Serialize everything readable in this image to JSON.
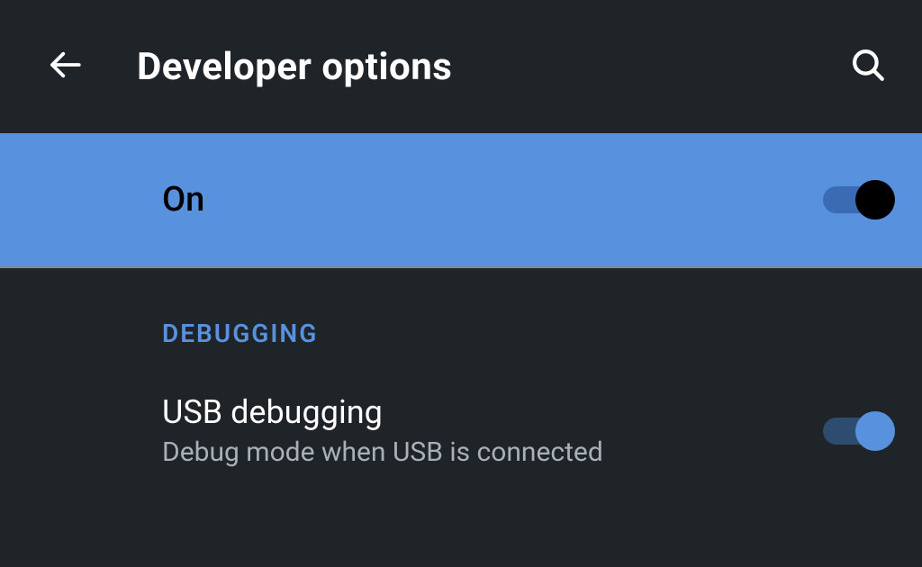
{
  "header": {
    "title": "Developer options"
  },
  "master_toggle": {
    "label": "On",
    "enabled": true
  },
  "sections": {
    "debugging": {
      "header": "DEBUGGING",
      "usb": {
        "title": "USB debugging",
        "subtitle": "Debug mode when USB is connected",
        "enabled": true
      }
    }
  },
  "colors": {
    "background": "#1f2429",
    "accent": "#5891de",
    "text_primary": "#ffffff",
    "text_secondary": "#a9b0b6"
  }
}
